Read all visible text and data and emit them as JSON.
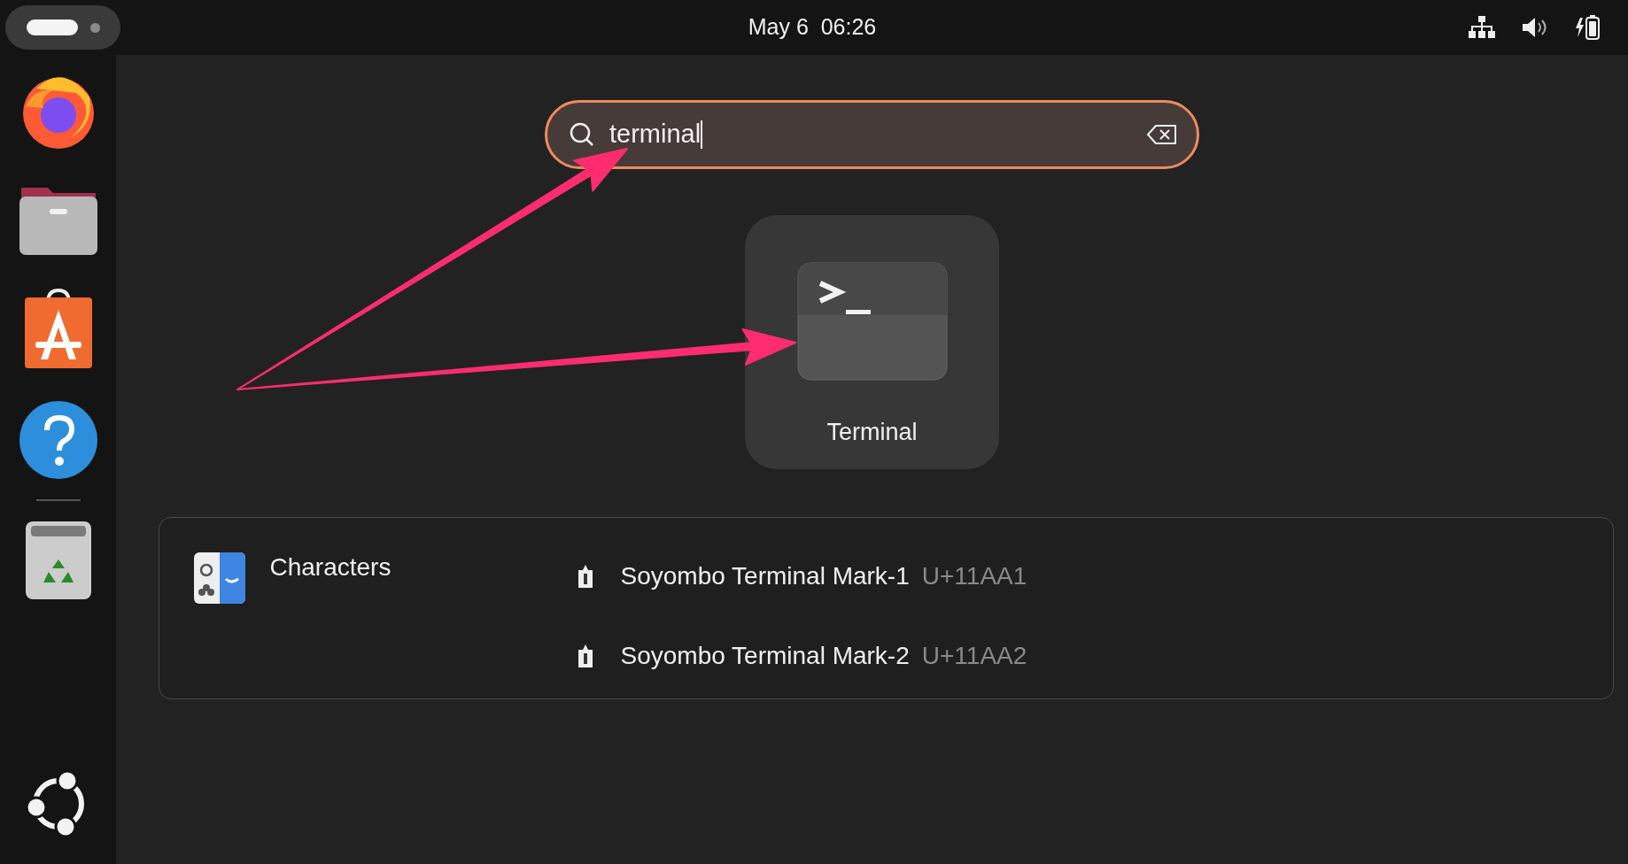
{
  "top_bar": {
    "clock": "May 6  06:26"
  },
  "search": {
    "value": "terminal"
  },
  "apps": [
    {
      "name": "Terminal"
    }
  ],
  "providers": [
    {
      "name": "Characters",
      "results": [
        {
          "name": "Soyombo Terminal Mark-1",
          "code": "U+11AA1"
        },
        {
          "name": "Soyombo Terminal Mark-2",
          "code": "U+11AA2"
        }
      ]
    }
  ]
}
